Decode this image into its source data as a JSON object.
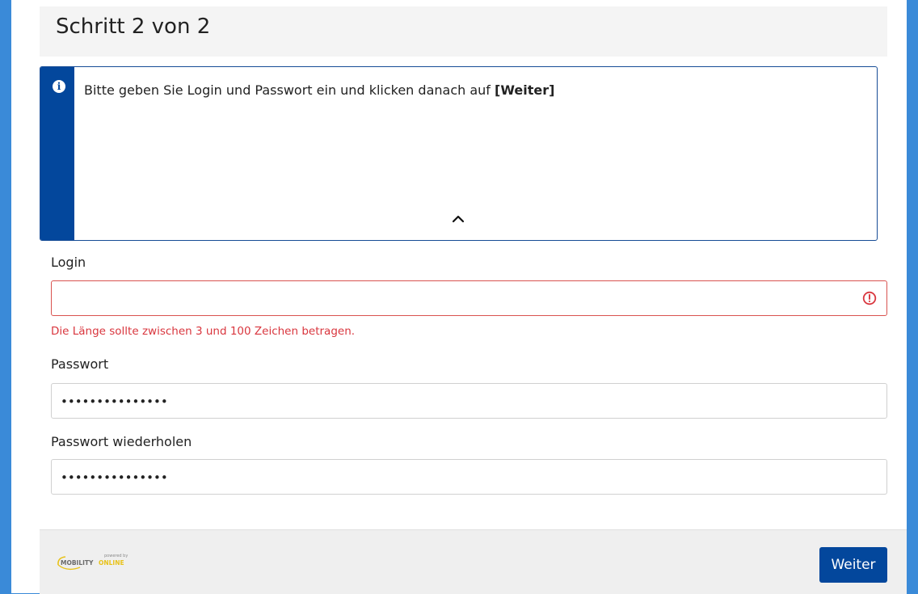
{
  "header": {
    "title": "Schritt 2 von 2"
  },
  "info": {
    "text_prefix": "Bitte geben Sie Login und Passwort ein und klicken danach auf ",
    "text_bold": "[Weiter]",
    "accent_color": "#03479c"
  },
  "form": {
    "login": {
      "label": "Login",
      "value": "",
      "error": "Die Länge sollte zwischen 3 und 100 Zeichen betragen.",
      "error_color": "#d9363e"
    },
    "password": {
      "label": "Passwort",
      "masked_value": "•••••••••••••••"
    },
    "password_repeat": {
      "label": "Passwort wiederholen",
      "masked_value": "•••••••••••••••"
    }
  },
  "footer": {
    "logo_powered": "powered by",
    "logo_word1": "MOBILITY",
    "logo_word2": "ONLINE",
    "submit_label": "Weiter"
  }
}
